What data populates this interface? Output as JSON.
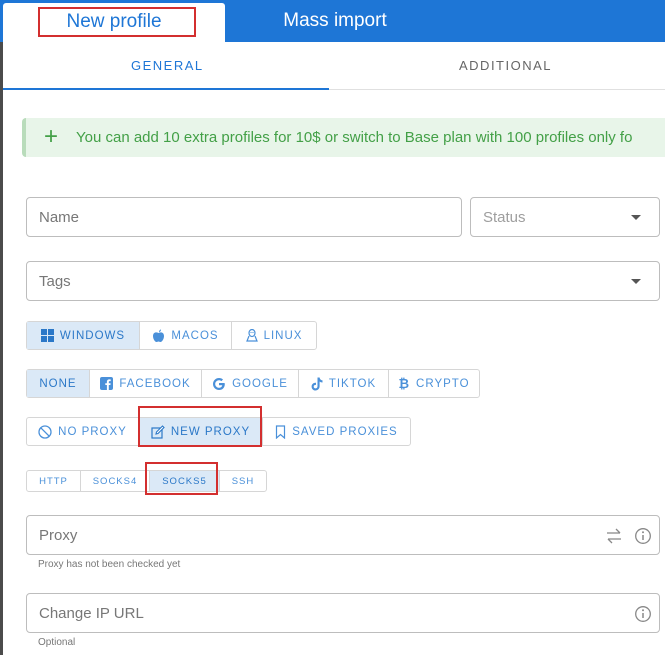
{
  "header": {
    "tabs": [
      {
        "label": "New profile",
        "active": true
      },
      {
        "label": "Mass import",
        "active": false
      }
    ]
  },
  "subtabs": [
    {
      "label": "GENERAL",
      "active": true
    },
    {
      "label": "ADDITIONAL",
      "active": false
    }
  ],
  "banner": {
    "icon": "plus-icon",
    "text": "You can add 10 extra profiles for 10$ or switch to Base plan with 100 profiles only fo"
  },
  "form": {
    "name_placeholder": "Name",
    "status_placeholder": "Status",
    "tags_placeholder": "Tags",
    "proxy_placeholder": "Proxy",
    "proxy_hint": "Proxy has not been checked yet",
    "change_ip_placeholder": "Change IP URL",
    "change_ip_hint": "Optional"
  },
  "os_options": [
    {
      "label": "WINDOWS",
      "icon": "windows-icon",
      "selected": true
    },
    {
      "label": "MACOS",
      "icon": "apple-icon",
      "selected": false
    },
    {
      "label": "LINUX",
      "icon": "linux-icon",
      "selected": false
    }
  ],
  "social_options": [
    {
      "label": "NONE",
      "selected": true
    },
    {
      "label": "FACEBOOK",
      "icon": "facebook-icon",
      "selected": false
    },
    {
      "label": "GOOGLE",
      "icon": "google-icon",
      "selected": false
    },
    {
      "label": "TIKTOK",
      "icon": "tiktok-icon",
      "selected": false
    },
    {
      "label": "CRYPTO",
      "icon": "bitcoin-icon",
      "selected": false
    }
  ],
  "proxy_modes": [
    {
      "label": "NO PROXY",
      "icon": "no-proxy-icon",
      "selected": false
    },
    {
      "label": "NEW PROXY",
      "icon": "edit-icon",
      "selected": true
    },
    {
      "label": "SAVED PROXIES",
      "icon": "bookmark-icon",
      "selected": false
    }
  ],
  "protocols": [
    {
      "label": "HTTP",
      "selected": false
    },
    {
      "label": "SOCKS4",
      "selected": false
    },
    {
      "label": "SOCKS5",
      "selected": true
    },
    {
      "label": "SSH",
      "selected": false
    }
  ],
  "colors": {
    "primary": "#1e76d6",
    "selected_bg": "#dbe9f7",
    "banner_bg": "#e8f5e9",
    "banner_text": "#43a047",
    "highlight_box": "#d32f2f"
  }
}
